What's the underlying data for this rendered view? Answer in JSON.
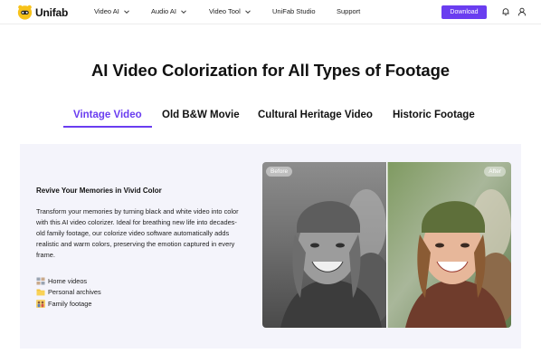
{
  "brand": {
    "name": "Unifab",
    "accent": "#6a3df0"
  },
  "nav": {
    "items": [
      {
        "label": "Video AI",
        "dropdown": true
      },
      {
        "label": "Audio AI",
        "dropdown": true
      },
      {
        "label": "Video Tool",
        "dropdown": true
      },
      {
        "label": "UniFab Studio",
        "dropdown": false
      },
      {
        "label": "Support",
        "dropdown": false
      }
    ],
    "download_label": "Download",
    "icons": [
      "bell-icon",
      "user-icon"
    ]
  },
  "page_title": "AI Video Colorization for All Types of Footage",
  "tabs": [
    {
      "label": "Vintage Video",
      "active": true
    },
    {
      "label": "Old B&W Movie",
      "active": false
    },
    {
      "label": "Cultural Heritage Video",
      "active": false
    },
    {
      "label": "Historic Footage",
      "active": false
    }
  ],
  "card": {
    "heading": "Revive Your Memories in Vivid Color",
    "body": "Transform your memories by turning black and white video into color with this AI video colorizer. Ideal for breathing new life into decades-old family footage, our colorize video software automatically adds realistic and warm colors, preserving the emotion captured in every frame.",
    "features": [
      {
        "icon": "film-frames-icon",
        "label": "Home videos"
      },
      {
        "icon": "folder-icon",
        "label": "Personal archives"
      },
      {
        "icon": "family-icon",
        "label": "Family footage"
      }
    ],
    "compare": {
      "before_label": "Before",
      "after_label": "After"
    }
  }
}
